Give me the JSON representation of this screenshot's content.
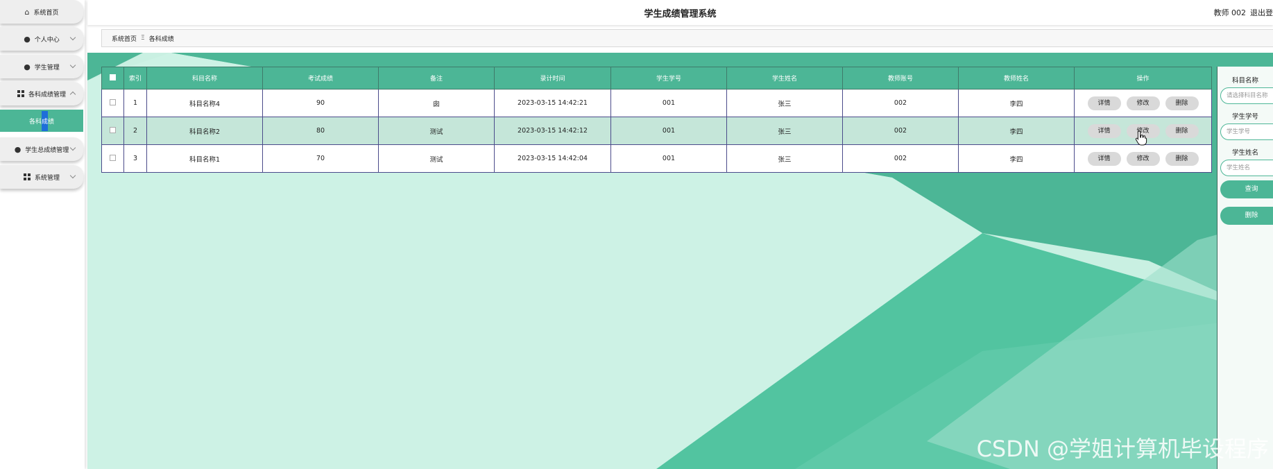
{
  "sidebar": {
    "items": [
      {
        "label": "系统首页",
        "icon": "home-icon",
        "chevron": ""
      },
      {
        "label": "个人中心",
        "icon": "person-icon",
        "chevron": "down"
      },
      {
        "label": "学生管理",
        "icon": "person-icon",
        "chevron": "down"
      },
      {
        "label": "各科成绩管理",
        "icon": "grid-icon",
        "chevron": "up"
      },
      {
        "label": "学生总成绩管理",
        "icon": "person-icon",
        "chevron": "down"
      },
      {
        "label": "系统管理",
        "icon": "grid-icon",
        "chevron": "down"
      }
    ],
    "sub_item": {
      "label_a": "各科",
      "label_b": "成",
      "label_c": "绩"
    }
  },
  "header": {
    "title": "学生成绩管理系统",
    "user": "教师 002",
    "logout": "退出登"
  },
  "breadcrumb": {
    "home": "系统首页",
    "separator": "Ξ",
    "current": "各科成绩"
  },
  "table": {
    "columns": [
      "索引",
      "科目名称",
      "考试成绩",
      "备注",
      "录计时间",
      "学生学号",
      "学生姓名",
      "教师账号",
      "教师姓名",
      "操作"
    ],
    "rows": [
      {
        "index": "1",
        "subject": "科目名称4",
        "score": "90",
        "note": "囱",
        "time": "2023-03-15 14:42:21",
        "student_no": "001",
        "student_name": "张三",
        "teacher_no": "002",
        "teacher_name": "李四"
      },
      {
        "index": "2",
        "subject": "科目名称2",
        "score": "80",
        "note": "测试",
        "time": "2023-03-15 14:42:12",
        "student_no": "001",
        "student_name": "张三",
        "teacher_no": "002",
        "teacher_name": "李四"
      },
      {
        "index": "3",
        "subject": "科目名称1",
        "score": "70",
        "note": "测试",
        "time": "2023-03-15 14:42:04",
        "student_no": "001",
        "student_name": "张三",
        "teacher_no": "002",
        "teacher_name": "李四"
      }
    ],
    "actions": {
      "detail": "详情",
      "edit": "修改",
      "delete": "删除"
    }
  },
  "search": {
    "subject_label": "科目名称",
    "subject_placeholder": "请选择科目名称",
    "student_no_label": "学生学号",
    "student_no_placeholder": "学生学号",
    "student_name_label": "学生姓名",
    "student_name_placeholder": "学生姓名",
    "query_button": "查询",
    "delete_button": "删除"
  },
  "watermark": "CSDN @学姐计算机毕设程序",
  "colors": {
    "accent": "#4cb696",
    "row_alt": "#c5e6d9",
    "bg": "#c9f0e2"
  }
}
